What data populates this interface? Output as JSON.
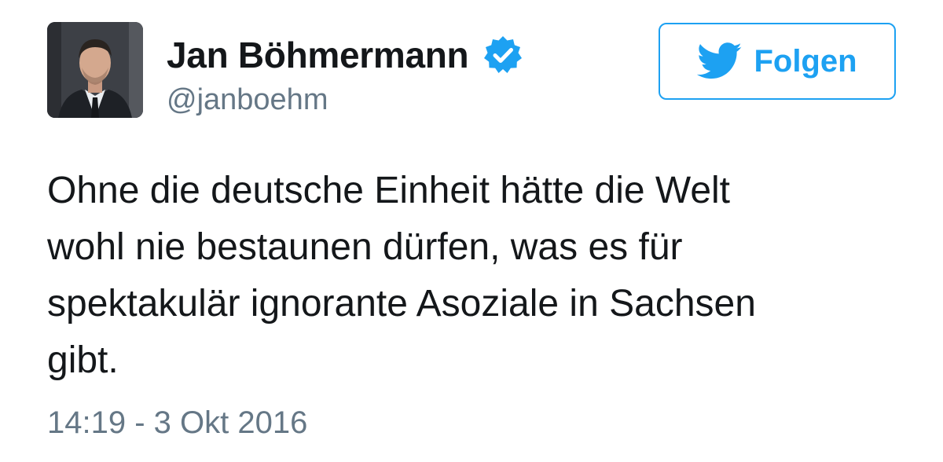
{
  "author": {
    "display_name": "Jan Böhmermann",
    "handle": "@janboehm",
    "verified": true,
    "verified_icon": "verified-badge-icon"
  },
  "follow_button": {
    "label": "Folgen",
    "icon": "twitter-bird-icon"
  },
  "tweet": {
    "text_lines": [
      "Ohne die deutsche Einheit hätte die Welt",
      "wohl nie bestaunen dürfen, was es für",
      "spektakulär ignorante Asoziale in Sachsen",
      "gibt."
    ],
    "timestamp": "14:19 - 3 Okt 2016"
  },
  "colors": {
    "brand_blue": "#1da1f2",
    "text": "#14171a",
    "secondary_text": "#657786"
  }
}
